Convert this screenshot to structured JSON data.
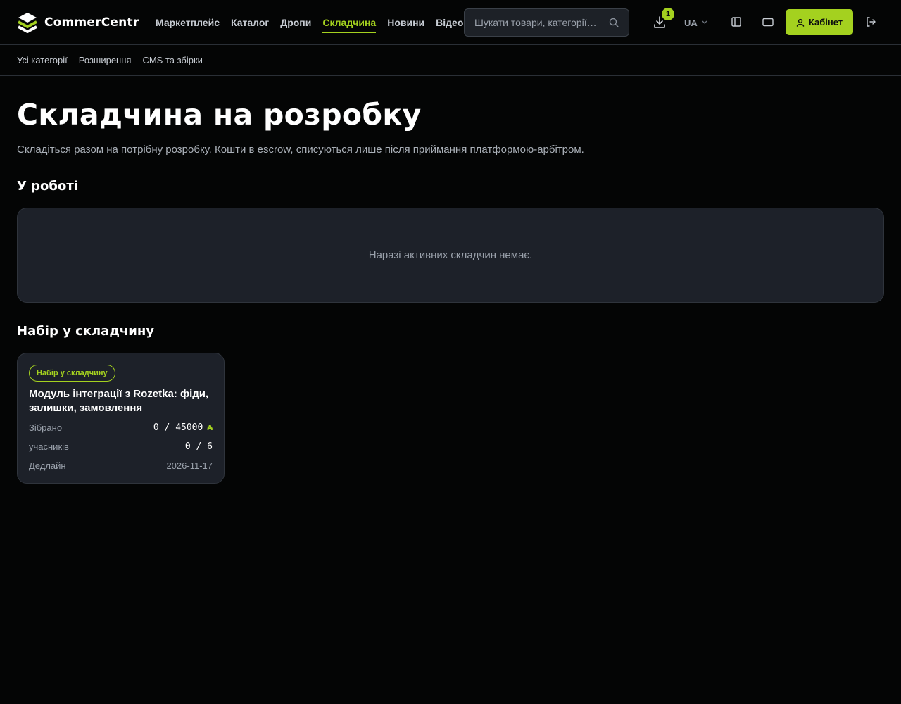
{
  "brand": {
    "name": "CommerCentr",
    "accent": "#a4d11f"
  },
  "nav": {
    "items": [
      {
        "label": "Маркетплейс",
        "active": false
      },
      {
        "label": "Каталог",
        "active": false
      },
      {
        "label": "Дропи",
        "active": false
      },
      {
        "label": "Складчина",
        "active": true
      },
      {
        "label": "Новини",
        "active": false
      },
      {
        "label": "Відео",
        "active": false
      }
    ]
  },
  "search": {
    "placeholder": "Шукати товари, категорії…",
    "icon": "search-icon"
  },
  "downloads": {
    "badge_count": "1",
    "icon": "download-icon"
  },
  "language": {
    "selected": "UA"
  },
  "header_icons": [
    "sidebar-panel-icon",
    "window-icon"
  ],
  "cabinet": {
    "label": "Кабінет",
    "icon": "user-icon"
  },
  "logout": {
    "icon": "logout-icon"
  },
  "subnav": {
    "items": [
      {
        "label": "Усі категорії"
      },
      {
        "label": "Розширення"
      },
      {
        "label": "CMS та збірки"
      }
    ]
  },
  "page": {
    "title": "Складчина на розробку",
    "subtitle": "Складіться разом на потрібну розробку. Кошти в escrow, списуються лише після приймання платформою-арбітром."
  },
  "in_progress": {
    "title": "У роботі",
    "empty_text": "Наразі активних складчин немає."
  },
  "recruiting": {
    "title": "Набір у складчину",
    "cards": [
      {
        "badge": "Набір у складчину",
        "title": "Модуль інтеграції з Rozetka: фіди, залишки, замовлення",
        "collected_label": "Зібрано",
        "collected_value": "0 / 45000",
        "currency_symbol": "₳",
        "participants_label": "учасників",
        "participants_value": "0 / 6",
        "deadline_label": "Дедлайн",
        "deadline_value": "2026-11-17"
      }
    ]
  }
}
